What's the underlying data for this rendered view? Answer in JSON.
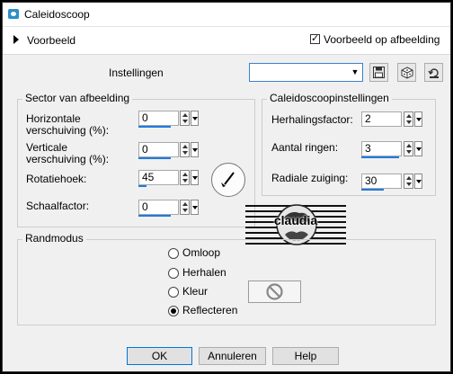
{
  "window": {
    "title": "Caleidoscoop"
  },
  "preview": {
    "toggle_label": "Voorbeeld",
    "checkbox_label": "Voorbeeld op afbeelding",
    "checkbox_checked": true
  },
  "presets": {
    "label": "Instellingen",
    "value": ""
  },
  "sector": {
    "title": "Sector van afbeelding",
    "h_offset": {
      "label_line1": "Horizontale",
      "label_line2": "verschuiving (%):",
      "value": "0"
    },
    "v_offset": {
      "label_line1": "Verticale",
      "label_line2": "verschuiving (%):",
      "value": "0"
    },
    "rotation": {
      "label": "Rotatiehoek:",
      "value": "45"
    },
    "scale": {
      "label": "Schaalfactor:",
      "value": "0"
    }
  },
  "kaleido": {
    "title": "Caleidoscoopinstellingen",
    "repeat": {
      "label": "Herhalingsfactor:",
      "value": "2"
    },
    "rings": {
      "label": "Aantal ringen:",
      "value": "3"
    },
    "radial": {
      "label": "Radiale zuiging:",
      "value": "30"
    }
  },
  "edge": {
    "title": "Randmodus",
    "options": [
      {
        "label": "Omloop",
        "selected": false
      },
      {
        "label": "Herhalen",
        "selected": false
      },
      {
        "label": "Kleur",
        "selected": false
      },
      {
        "label": "Reflecteren",
        "selected": true
      }
    ]
  },
  "watermark": {
    "text": "claudia"
  },
  "buttons": {
    "ok": "OK",
    "cancel": "Annuleren",
    "help": "Help"
  }
}
